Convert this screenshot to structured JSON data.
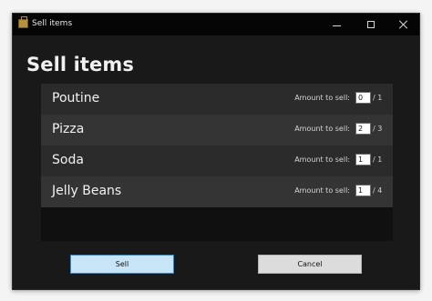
{
  "window": {
    "title": "Sell items",
    "controls": {
      "minimize_icon": "minimize-icon",
      "maximize_icon": "maximize-icon",
      "close_icon": "close-icon"
    }
  },
  "page": {
    "heading": "Sell items"
  },
  "items": [
    {
      "name": "Poutine",
      "amount_label": "Amount to sell:",
      "amount": "0",
      "max": "/ 1"
    },
    {
      "name": "Pizza",
      "amount_label": "Amount to sell:",
      "amount": "2",
      "max": "/ 3"
    },
    {
      "name": "Soda",
      "amount_label": "Amount to sell:",
      "amount": "1",
      "max": "/ 1"
    },
    {
      "name": "Jelly Beans",
      "amount_label": "Amount to sell:",
      "amount": "1",
      "max": "/ 4"
    }
  ],
  "actions": {
    "sell_label": "Sell",
    "cancel_label": "Cancel"
  },
  "colors": {
    "window_bg": "#191919",
    "row_bg": "#2b2b2b",
    "row_alt_bg": "#343434",
    "accent": "#2e8bd2"
  }
}
